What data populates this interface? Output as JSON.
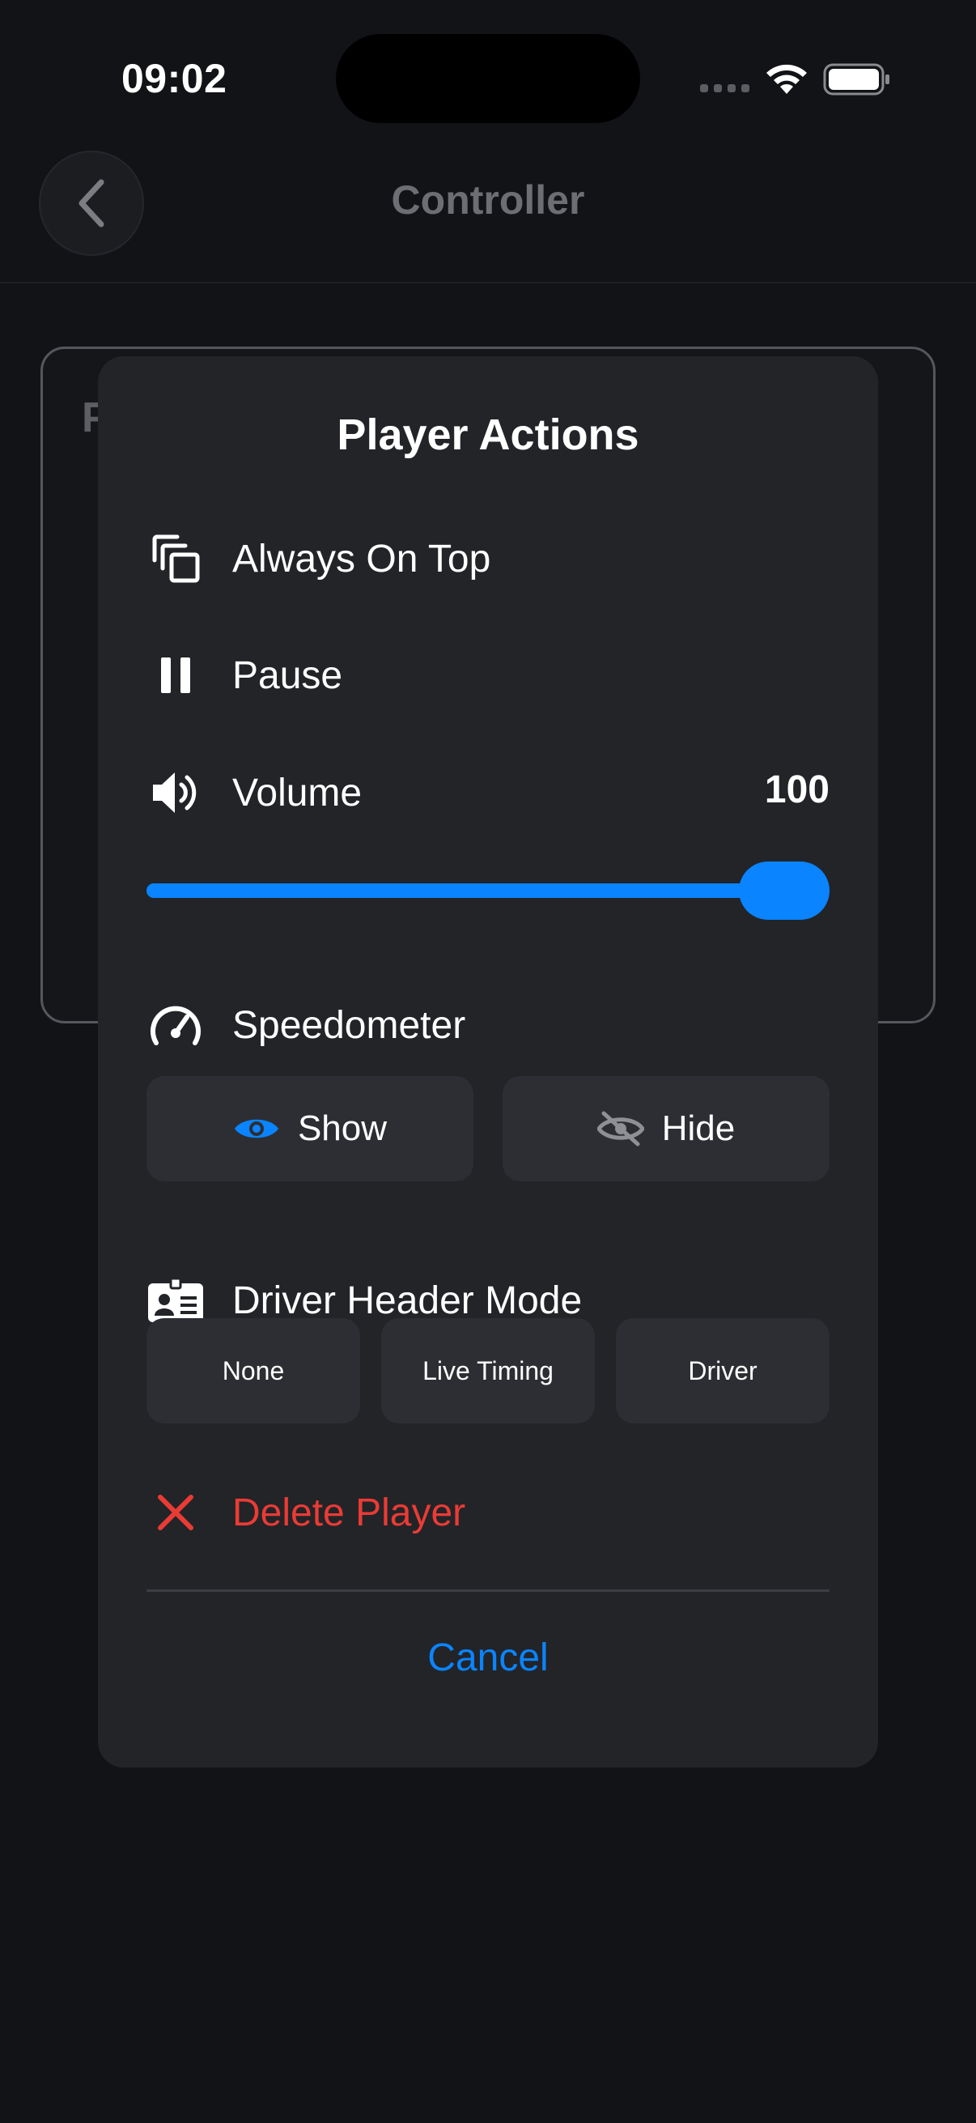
{
  "status_bar": {
    "time": "09:02"
  },
  "nav": {
    "title": "Controller"
  },
  "background_card": {
    "title_partial": "P"
  },
  "modal": {
    "title": "Player Actions",
    "always_on_top_label": "Always On Top",
    "pause_label": "Pause",
    "volume_label": "Volume",
    "volume_value": "100",
    "volume_level_percent": 100,
    "speedometer_label": "Speedometer",
    "show_label": "Show",
    "hide_label": "Hide",
    "driver_header_label": "Driver Header Mode",
    "driver_header_options": [
      "None",
      "Live Timing",
      "Driver"
    ],
    "delete_label": "Delete Player",
    "cancel_label": "Cancel"
  },
  "colors": {
    "accent": "#0a84ff",
    "danger": "#ea3b35",
    "modal_bg": "#222428",
    "page_bg": "#121316"
  },
  "icons": {
    "always_on_top": "copy-stack-icon",
    "pause": "pause-icon",
    "volume": "speaker-icon",
    "speedometer": "gauge-icon",
    "show": "eye-icon",
    "hide": "eye-slash-icon",
    "driver_header": "id-card-icon",
    "delete": "close-x-icon",
    "back": "chevron-left-icon"
  }
}
